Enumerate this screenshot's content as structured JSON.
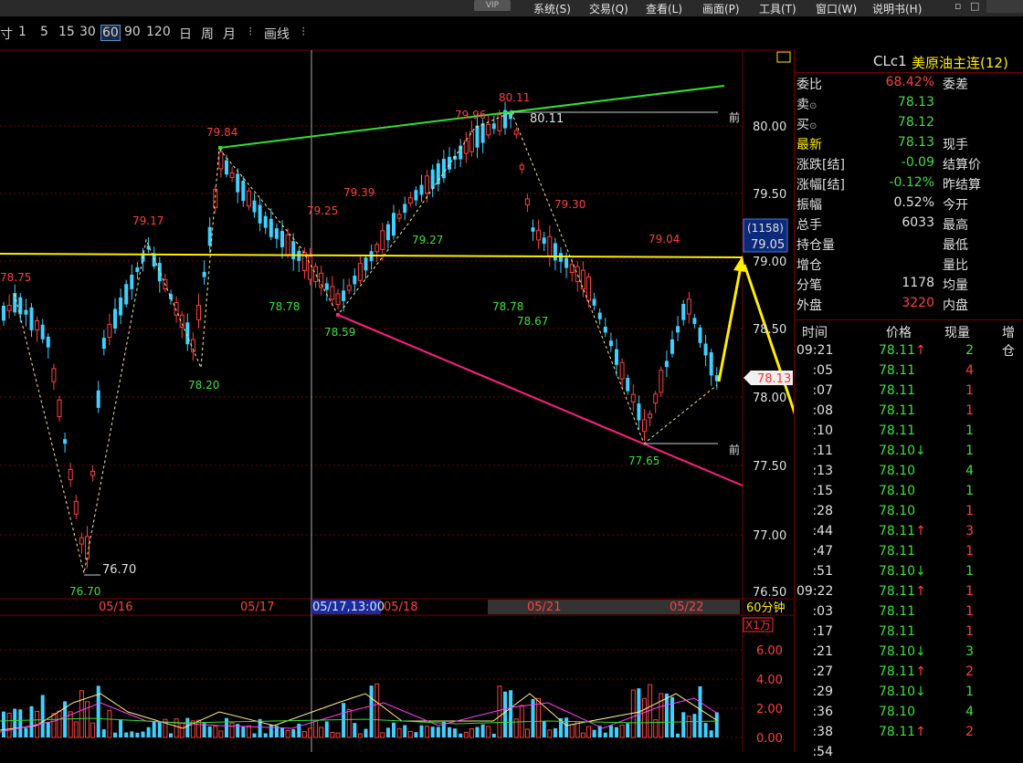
{
  "menu": {
    "vip": "VIP",
    "items": [
      "系统(S)",
      "交易(Q)",
      "查看(L)",
      "画面(P)",
      "工具(T)",
      "窗口(W)",
      "说明书(H)"
    ]
  },
  "toolbar": {
    "periods": [
      "寸",
      "1",
      "5",
      "15",
      "30",
      "60",
      "90",
      "120",
      "日",
      "周",
      "月"
    ],
    "active_period": "60",
    "draw_tool": "画线",
    "sep": "⁝"
  },
  "chart": {
    "period_label": "60分钟",
    "x_labels": [
      "05/16",
      "05/17",
      "05/17,13:00",
      "05/18",
      "05/21",
      "05/22"
    ],
    "y_ticks": [
      "80.00",
      "79.50",
      "79.00",
      "78.50",
      "78.00",
      "77.50",
      "77.00",
      "76.50"
    ],
    "vol_unit": "X1万",
    "vol_ticks": [
      "6.00",
      "4.00",
      "2.00",
      "0.00"
    ],
    "high_label": "80.11",
    "low_label": "76.70",
    "cursor_box_vol": "(1158)",
    "cursor_box_price": "79.05",
    "last_price_tag": "78.13",
    "front_mark": "前",
    "pivots": [
      {
        "v": "78.75",
        "c": "#ff4040"
      },
      {
        "v": "79.17",
        "c": "#ff4040"
      },
      {
        "v": "79.84",
        "c": "#ff4040"
      },
      {
        "v": "79.25",
        "c": "#ff4040"
      },
      {
        "v": "79.39",
        "c": "#ff4040"
      },
      {
        "v": "79.96",
        "c": "#ff4040"
      },
      {
        "v": "80.11",
        "c": "#ff4040"
      },
      {
        "v": "79.30",
        "c": "#ff4040"
      },
      {
        "v": "79.04",
        "c": "#ff4040"
      },
      {
        "v": "76.70",
        "c": "#40e040"
      },
      {
        "v": "78.20",
        "c": "#40e040"
      },
      {
        "v": "78.78",
        "c": "#40e040"
      },
      {
        "v": "78.59",
        "c": "#40e040"
      },
      {
        "v": "79.27",
        "c": "#40e040"
      },
      {
        "v": "78.78",
        "c": "#40e040"
      },
      {
        "v": "78.67",
        "c": "#40e040"
      },
      {
        "v": "77.65",
        "c": "#40e040"
      }
    ]
  },
  "quote": {
    "symbol": "CLc1",
    "name": "美原油主连(12)",
    "rows": [
      {
        "l": "委比",
        "v": "68.42%",
        "vc": "#ff4040",
        "r": "委差"
      },
      {
        "l": "卖",
        "v": "78.13",
        "vc": "#40e040",
        "r": ""
      },
      {
        "l": "买",
        "v": "78.12",
        "vc": "#40e040",
        "r": ""
      },
      {
        "l": "最新",
        "v": "78.13",
        "vc": "#40e040",
        "r": "现手"
      },
      {
        "l": "涨跌[结]",
        "v": "-0.09",
        "vc": "#40e040",
        "r": "结算价"
      },
      {
        "l": "涨幅[结]",
        "v": "-0.12%",
        "vc": "#40e040",
        "r": "昨结算"
      },
      {
        "l": "振幅",
        "v": "0.52%",
        "vc": "#e0e0e0",
        "r": "今开"
      },
      {
        "l": "总手",
        "v": "6033",
        "vc": "#e0e0e0",
        "r": "最高"
      },
      {
        "l": "持仓量",
        "v": "",
        "vc": "#e0e0e0",
        "r": "最低"
      },
      {
        "l": "增仓",
        "v": "",
        "vc": "#e0e0e0",
        "r": "量比"
      },
      {
        "l": "分笔",
        "v": "1178",
        "vc": "#e0e0e0",
        "r": "均量"
      },
      {
        "l": "外盘",
        "v": "3220",
        "vc": "#ff4040",
        "r": "内盘"
      }
    ],
    "sell_mark": "⊙",
    "buy_mark": "⊙"
  },
  "ticks": {
    "headers": [
      "时间",
      "价格",
      "现量",
      "增仓"
    ],
    "rows": [
      {
        "t": "09:21",
        "p": "78.11↑",
        "v": "2",
        "vc": "#40e040"
      },
      {
        "t": ":05",
        "p": "78.11",
        "v": "4",
        "vc": "#ff4040"
      },
      {
        "t": ":07",
        "p": "78.11",
        "v": "1",
        "vc": "#ff4040"
      },
      {
        "t": ":08",
        "p": "78.11",
        "v": "1",
        "vc": "#ff4040"
      },
      {
        "t": ":10",
        "p": "78.11",
        "v": "1",
        "vc": "#40e040"
      },
      {
        "t": ":11",
        "p": "78.10↓",
        "v": "1",
        "vc": "#40e040"
      },
      {
        "t": ":13",
        "p": "78.10",
        "v": "4",
        "vc": "#40e040"
      },
      {
        "t": ":15",
        "p": "78.10",
        "v": "1",
        "vc": "#40e040"
      },
      {
        "t": ":28",
        "p": "78.10",
        "v": "1",
        "vc": "#ff4040"
      },
      {
        "t": ":44",
        "p": "78.11↑",
        "v": "3",
        "vc": "#ff4040"
      },
      {
        "t": ":47",
        "p": "78.11",
        "v": "1",
        "vc": "#ff4040"
      },
      {
        "t": ":51",
        "p": "78.10↓",
        "v": "1",
        "vc": "#40e040"
      },
      {
        "t": "09:22",
        "p": "78.11↑",
        "v": "1",
        "vc": "#ff4040"
      },
      {
        "t": ":03",
        "p": "78.11",
        "v": "1",
        "vc": "#ff4040"
      },
      {
        "t": ":17",
        "p": "78.11",
        "v": "1",
        "vc": "#ff4040"
      },
      {
        "t": ":21",
        "p": "78.10↓",
        "v": "3",
        "vc": "#40e040"
      },
      {
        "t": ":27",
        "p": "78.11↑",
        "v": "2",
        "vc": "#ff4040"
      },
      {
        "t": ":29",
        "p": "78.10↓",
        "v": "1",
        "vc": "#40e040"
      },
      {
        "t": ":36",
        "p": "78.10",
        "v": "4",
        "vc": "#40e040"
      },
      {
        "t": ":38",
        "p": "78.11↑",
        "v": "2",
        "vc": "#ff4040"
      },
      {
        "t": ":54",
        "p": "",
        "v": "",
        "vc": "#ff4040"
      }
    ]
  },
  "colors": {
    "up": "#ff4040",
    "down": "#40d0ff",
    "grid": "#7a0000",
    "resistance": "#30e030",
    "support": "#ff2080",
    "price_line": "#ffee00"
  }
}
